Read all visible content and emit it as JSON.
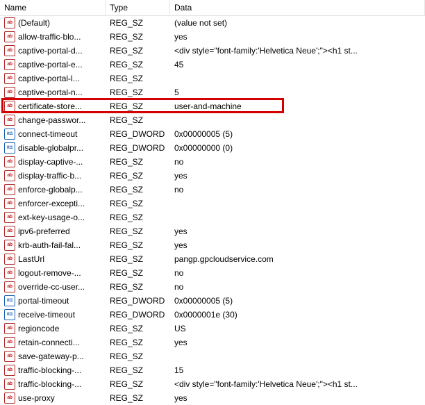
{
  "columns": {
    "name": "Name",
    "type": "Type",
    "data": "Data"
  },
  "icon_glyphs": {
    "sz": "ab",
    "dw": "011"
  },
  "highlight_index": 6,
  "entries": [
    {
      "icon": "sz",
      "name": "(Default)",
      "type": "REG_SZ",
      "data": "(value not set)"
    },
    {
      "icon": "sz",
      "name": "allow-traffic-blo...",
      "type": "REG_SZ",
      "data": "yes"
    },
    {
      "icon": "sz",
      "name": "captive-portal-d...",
      "type": "REG_SZ",
      "data": "<div style=\"font-family:'Helvetica Neue';\"><h1 st..."
    },
    {
      "icon": "sz",
      "name": "captive-portal-e...",
      "type": "REG_SZ",
      "data": "45"
    },
    {
      "icon": "sz",
      "name": "captive-portal-l...",
      "type": "REG_SZ",
      "data": ""
    },
    {
      "icon": "sz",
      "name": "captive-portal-n...",
      "type": "REG_SZ",
      "data": "5"
    },
    {
      "icon": "sz",
      "name": "certificate-store...",
      "type": "REG_SZ",
      "data": "user-and-machine"
    },
    {
      "icon": "sz",
      "name": "change-passwor...",
      "type": "REG_SZ",
      "data": ""
    },
    {
      "icon": "dw",
      "name": "connect-timeout",
      "type": "REG_DWORD",
      "data": "0x00000005 (5)"
    },
    {
      "icon": "dw",
      "name": "disable-globalpr...",
      "type": "REG_DWORD",
      "data": "0x00000000 (0)"
    },
    {
      "icon": "sz",
      "name": "display-captive-...",
      "type": "REG_SZ",
      "data": "no"
    },
    {
      "icon": "sz",
      "name": "display-traffic-b...",
      "type": "REG_SZ",
      "data": "yes"
    },
    {
      "icon": "sz",
      "name": "enforce-globalp...",
      "type": "REG_SZ",
      "data": "no"
    },
    {
      "icon": "sz",
      "name": "enforcer-excepti...",
      "type": "REG_SZ",
      "data": ""
    },
    {
      "icon": "sz",
      "name": "ext-key-usage-o...",
      "type": "REG_SZ",
      "data": ""
    },
    {
      "icon": "sz",
      "name": "ipv6-preferred",
      "type": "REG_SZ",
      "data": "yes"
    },
    {
      "icon": "sz",
      "name": "krb-auth-fail-fal...",
      "type": "REG_SZ",
      "data": "yes"
    },
    {
      "icon": "sz",
      "name": "LastUrl",
      "type": "REG_SZ",
      "data": "pangp.gpcloudservice.com"
    },
    {
      "icon": "sz",
      "name": "logout-remove-...",
      "type": "REG_SZ",
      "data": "no"
    },
    {
      "icon": "sz",
      "name": "override-cc-user...",
      "type": "REG_SZ",
      "data": "no"
    },
    {
      "icon": "dw",
      "name": "portal-timeout",
      "type": "REG_DWORD",
      "data": "0x00000005 (5)"
    },
    {
      "icon": "dw",
      "name": "receive-timeout",
      "type": "REG_DWORD",
      "data": "0x0000001e (30)"
    },
    {
      "icon": "sz",
      "name": "regioncode",
      "type": "REG_SZ",
      "data": "US"
    },
    {
      "icon": "sz",
      "name": "retain-connecti...",
      "type": "REG_SZ",
      "data": "yes"
    },
    {
      "icon": "sz",
      "name": "save-gateway-p...",
      "type": "REG_SZ",
      "data": ""
    },
    {
      "icon": "sz",
      "name": "traffic-blocking-...",
      "type": "REG_SZ",
      "data": "15"
    },
    {
      "icon": "sz",
      "name": "traffic-blocking-...",
      "type": "REG_SZ",
      "data": "<div style=\"font-family:'Helvetica Neue';\"><h1 st..."
    },
    {
      "icon": "sz",
      "name": "use-proxy",
      "type": "REG_SZ",
      "data": "yes"
    }
  ]
}
